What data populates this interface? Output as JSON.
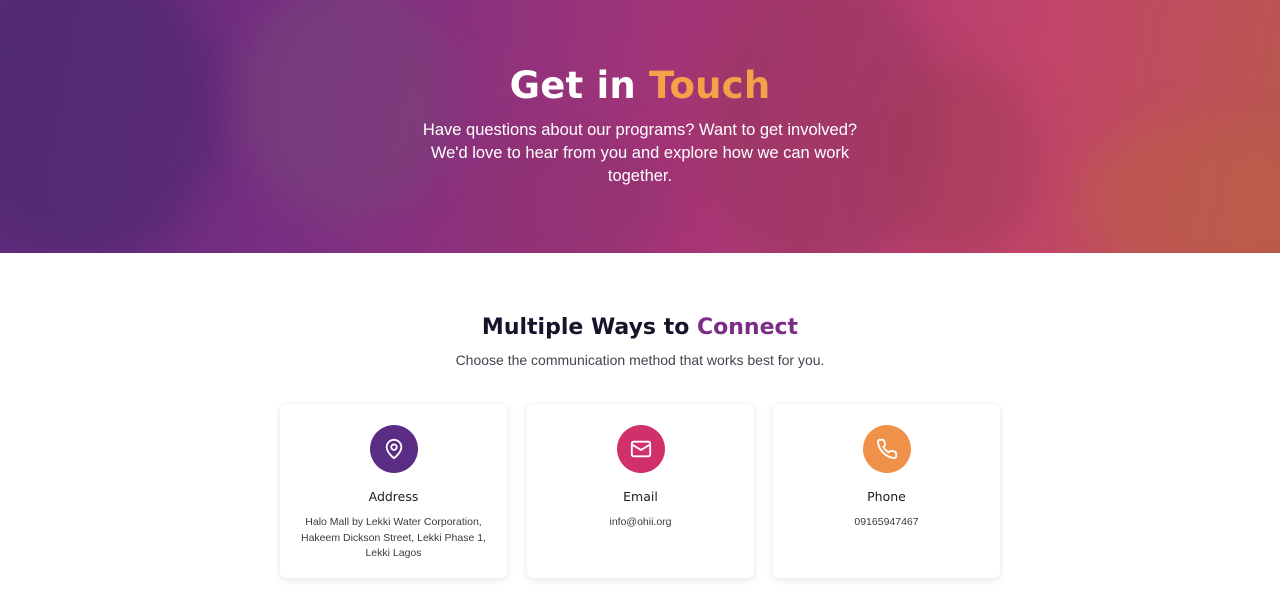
{
  "hero": {
    "title_part1": "Get in",
    "title_accent": "Touch",
    "subtitle": "Have questions about our programs? Want to get involved? We'd love to hear from you and explore how we can work together."
  },
  "section": {
    "title_part1": "Multiple Ways to",
    "title_accent": "Connect",
    "subtitle": "Choose the communication method that works best for you."
  },
  "cards": [
    {
      "icon": "map-pin-icon",
      "color": "#5b2c83",
      "title": "Address",
      "value": "Halo Mall by Lekki Water Corporation, Hakeem Dickson Street, Lekki Phase 1, Lekki Lagos"
    },
    {
      "icon": "mail-icon",
      "color": "#d1316b",
      "title": "Email",
      "value": "info@ohii.org"
    },
    {
      "icon": "phone-icon",
      "color": "#f0914a",
      "title": "Phone",
      "value": "09165947467"
    }
  ],
  "colors": {
    "accent_orange": "#f4a24a",
    "accent_purple": "#7b2d86"
  }
}
